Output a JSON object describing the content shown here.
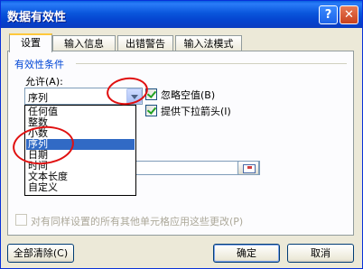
{
  "window": {
    "title": "数据有效性"
  },
  "tabs": [
    {
      "label": "设置"
    },
    {
      "label": "输入信息"
    },
    {
      "label": "出错警告"
    },
    {
      "label": "输入法模式"
    }
  ],
  "group": {
    "label": "有效性条件"
  },
  "allow": {
    "label": "允许(A):",
    "value": "序列",
    "options": [
      "任何值",
      "整数",
      "小数",
      "序列",
      "日期",
      "时间",
      "文本长度",
      "自定义"
    ],
    "selected_index": 3
  },
  "checkboxes": {
    "ignore_blank": {
      "label": "忽略空值(B)",
      "checked": true
    },
    "dropdown_arrow": {
      "label": "提供下拉箭头(I)",
      "checked": true
    }
  },
  "apply_all": {
    "label": "对有同样设置的所有其他单元格应用这些更改(P)",
    "checked": false,
    "disabled": true
  },
  "buttons": {
    "clear_all": "全部清除(C)",
    "ok": "确定",
    "cancel": "取消"
  },
  "annotation_color": "#e01010"
}
